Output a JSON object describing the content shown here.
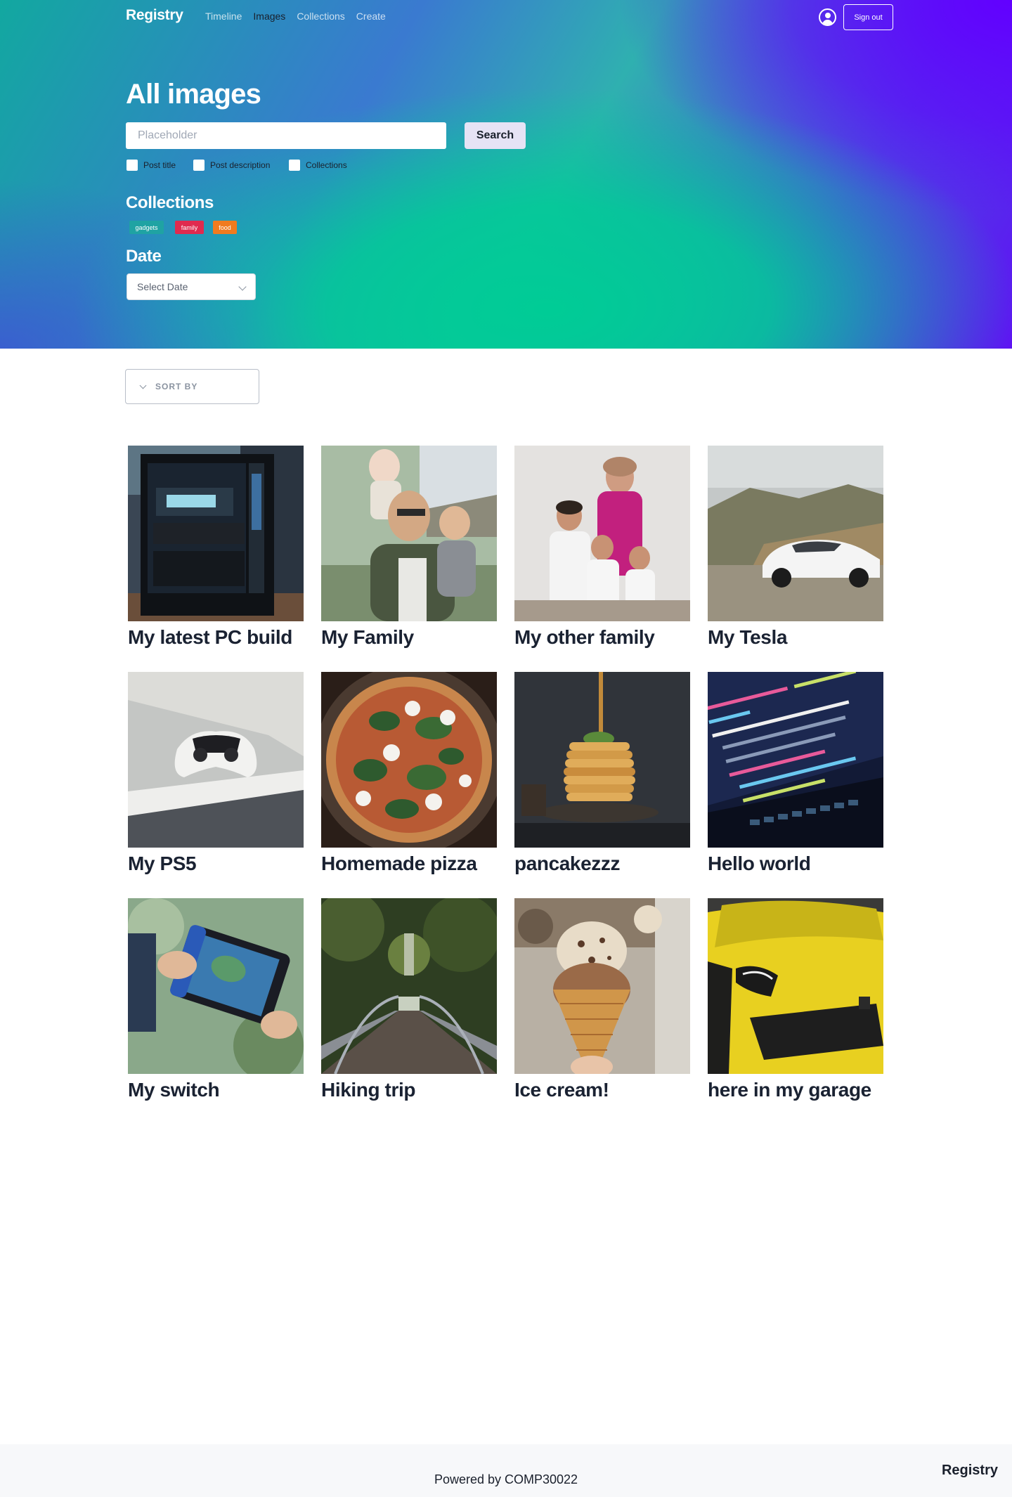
{
  "header": {
    "brand": "Registry",
    "nav": [
      "Timeline",
      "Images",
      "Collections",
      "Create"
    ],
    "active_nav": "Images",
    "account_icon": "user-circle-icon",
    "signout_label": "Sign out"
  },
  "hero": {
    "title": "All images",
    "search": {
      "placeholder": "Placeholder",
      "value": "",
      "button_label": "Search"
    },
    "filters": [
      {
        "label": "Post title",
        "checked": false
      },
      {
        "label": "Post description",
        "checked": false
      },
      {
        "label": "Collections",
        "checked": false
      }
    ],
    "collections_heading": "Collections",
    "collections": [
      {
        "label": "gadgets",
        "color": "#1fa3a3"
      },
      {
        "label": "family",
        "color": "#e02a4f"
      },
      {
        "label": "food",
        "color": "#f07b1f"
      }
    ],
    "date_heading": "Date",
    "date_select": "Select Date"
  },
  "sort": {
    "label": "SORT BY",
    "icon": "chevron-down-icon"
  },
  "gallery": [
    {
      "title": "My latest PC build",
      "image": "pc-build-photo"
    },
    {
      "title": "My Family",
      "image": "family-photo"
    },
    {
      "title": "My other family",
      "image": "other-family-photo"
    },
    {
      "title": "My Tesla",
      "image": "tesla-photo"
    },
    {
      "title": "My PS5",
      "image": "ps5-photo"
    },
    {
      "title": "Homemade pizza",
      "image": "pizza-photo"
    },
    {
      "title": "pancakezzz",
      "image": "pancakes-photo"
    },
    {
      "title": "Hello world",
      "image": "code-laptop-photo"
    },
    {
      "title": "My switch",
      "image": "switch-photo"
    },
    {
      "title": "Hiking trip",
      "image": "hiking-bridge-photo"
    },
    {
      "title": "Ice cream!",
      "image": "ice-cream-photo"
    },
    {
      "title": "here in my garage",
      "image": "yellow-car-photo"
    }
  ],
  "footer": {
    "powered": "Powered by COMP30022",
    "brand": "Registry"
  }
}
